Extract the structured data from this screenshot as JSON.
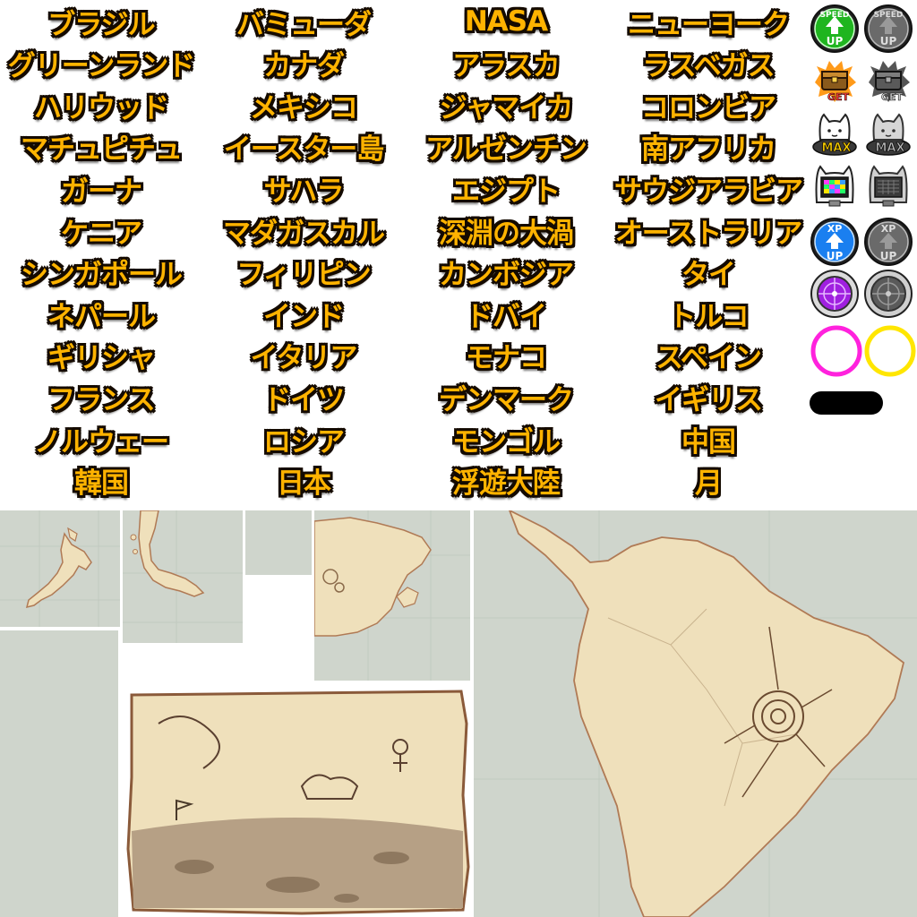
{
  "labels": [
    "ブラジル",
    "バミューダ",
    "NASA",
    "ニューヨーク",
    "グリーンランド",
    "カナダ",
    "アラスカ",
    "ラスベガス",
    "ハリウッド",
    "メキシコ",
    "ジャマイカ",
    "コロンビア",
    "マチュピチュ",
    "イースター島",
    "アルゼンチン",
    "南アフリカ",
    "ガーナ",
    "サハラ",
    "エジプト",
    "サウジアラビア",
    "ケニア",
    "マダガスカル",
    "深淵の大渦",
    "オーストラリア",
    "シンガポール",
    "フィリピン",
    "カンボジア",
    "タイ",
    "ネパール",
    "インド",
    "ドバイ",
    "トルコ",
    "ギリシャ",
    "イタリア",
    "モナコ",
    "スペイン",
    "フランス",
    "ドイツ",
    "デンマーク",
    "イギリス",
    "ノルウェー",
    "ロシア",
    "モンゴル",
    "中国",
    "韓国",
    "日本",
    "浮遊大陸",
    "月"
  ],
  "icons": {
    "speed_label": "SPEED",
    "up_label": "UP",
    "get_label": "GET",
    "max_label": "MAX",
    "xp_label": "XP"
  },
  "colors": {
    "label_fill": "#ffb300",
    "label_outline": "#140a00",
    "speed_active": "#1fb51f",
    "xp_active": "#1a7ff0",
    "radar_active": "#a020e0",
    "ring_magenta": "#ff22dd",
    "ring_yellow": "#ffe600",
    "parchment": "#efe0bb",
    "ocean": "#cfd5cc"
  }
}
